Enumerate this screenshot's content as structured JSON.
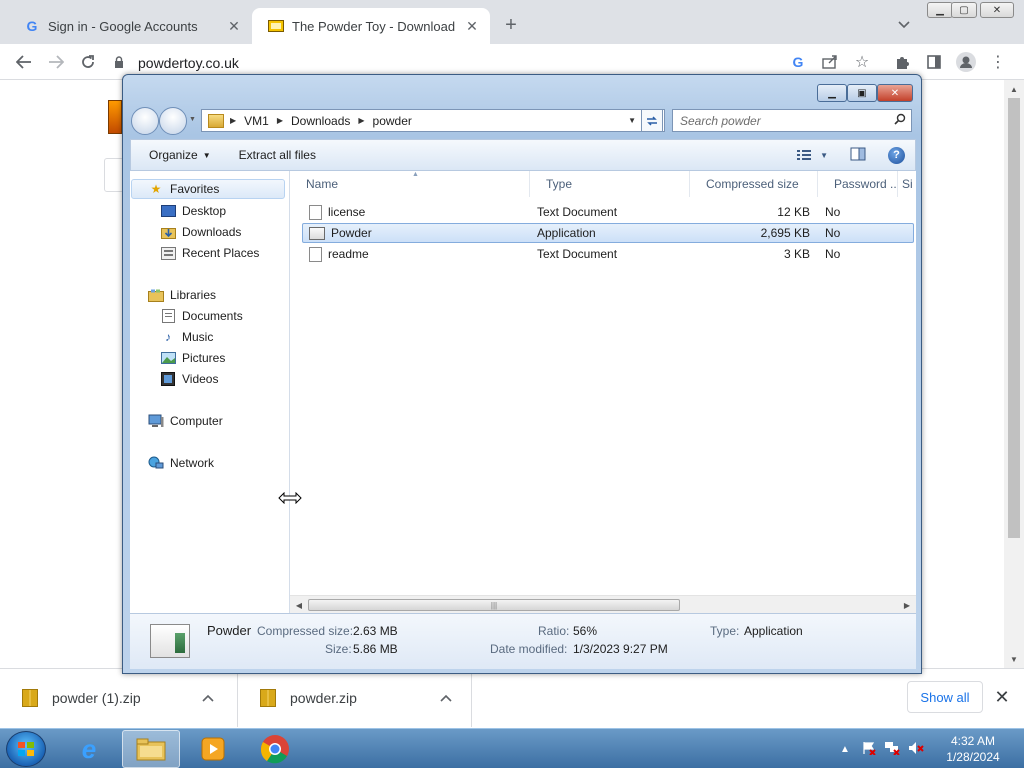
{
  "browser": {
    "tabs": [
      {
        "title": "Sign in - Google Accounts",
        "favicon": "google-icon"
      },
      {
        "title": "The Powder Toy - Download",
        "favicon": "powder-toy-icon"
      }
    ],
    "url": "powdertoy.co.uk"
  },
  "explorer": {
    "breadcrumb": [
      "VM1",
      "Downloads",
      "powder"
    ],
    "search_placeholder": "Search powder",
    "commands": {
      "organize": "Organize",
      "extract_all": "Extract all files"
    },
    "nav": {
      "favorites": "Favorites",
      "favorites_items": [
        "Desktop",
        "Downloads",
        "Recent Places"
      ],
      "libraries": "Libraries",
      "libraries_items": [
        "Documents",
        "Music",
        "Pictures",
        "Videos"
      ],
      "computer": "Computer",
      "network": "Network"
    },
    "columns": [
      "Name",
      "Type",
      "Compressed size",
      "Password ...",
      "Si"
    ],
    "files": [
      {
        "name": "license",
        "type": "Text Document",
        "compressed_size": "12 KB",
        "password": "No",
        "icon": "text-file-icon"
      },
      {
        "name": "Powder",
        "type": "Application",
        "compressed_size": "2,695 KB",
        "password": "No",
        "icon": "application-icon"
      },
      {
        "name": "readme",
        "type": "Text Document",
        "compressed_size": "3 KB",
        "password": "No",
        "icon": "text-file-icon"
      }
    ],
    "details": {
      "name": "Powder",
      "compressed_size_label": "Compressed size:",
      "compressed_size": "2.63 MB",
      "size_label": "Size:",
      "size": "5.86 MB",
      "ratio_label": "Ratio:",
      "ratio": "56%",
      "date_label": "Date modified:",
      "date": "1/3/2023 9:27 PM",
      "type_label": "Type:",
      "type": "Application"
    }
  },
  "downloads": {
    "items": [
      "powder (1).zip",
      "powder.zip"
    ],
    "show_all": "Show all"
  },
  "taskbar": {
    "time": "4:32 AM",
    "date": "1/28/2024"
  },
  "colors": {
    "chrome_frame": "#dee1e6",
    "link_blue": "#1a73e8",
    "win7_selection": "#cce0f8"
  }
}
